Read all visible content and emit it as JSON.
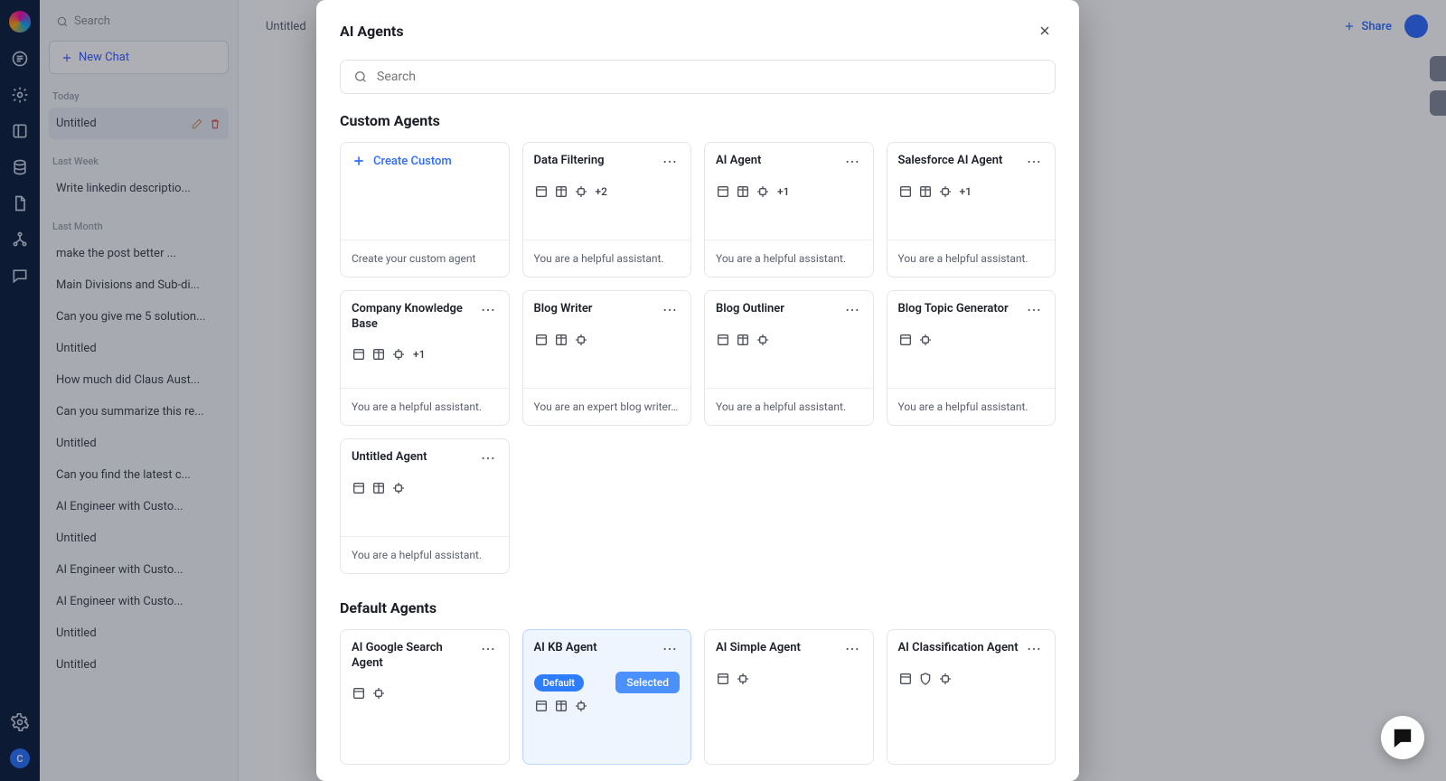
{
  "rail": {
    "icons": [
      "logo",
      "chat",
      "gear",
      "column",
      "database",
      "document",
      "tree",
      "bubble"
    ],
    "avatar_letter": "C"
  },
  "sidebar": {
    "search_placeholder": "Search",
    "new_chat_label": "New Chat",
    "today_label": "Today",
    "last_week_label": "Last Week",
    "last_month_label": "Last Month",
    "today_items": [
      "Untitled"
    ],
    "last_week_items": [
      "Write linkedin descriptio..."
    ],
    "last_month_items": [
      "make the post better ...",
      "Main Divisions and Sub-di...",
      "Can you give me 5 solution...",
      "Untitled",
      "How much did Claus Aust...",
      "Can you summarize this re...",
      "Untitled",
      "Can you find the latest c...",
      "AI Engineer with Custo...",
      "Untitled",
      "AI Engineer with Custo...",
      "AI Engineer with Custo...",
      "Untitled",
      "Untitled"
    ]
  },
  "topbar": {
    "untitled_label": "Untitled",
    "share_label": "Share"
  },
  "modal": {
    "title": "AI Agents",
    "search_placeholder": "Search",
    "custom_title": "Custom Agents",
    "default_title": "Default Agents",
    "create_label": "Create Custom",
    "create_desc": "Create your custom agent",
    "custom": [
      {
        "title": "Data Filtering",
        "desc": "You are a helpful assistant.",
        "plus": "+2",
        "icons": 3
      },
      {
        "title": "AI Agent",
        "desc": "You are a helpful assistant.",
        "plus": "+1",
        "icons": 3
      },
      {
        "title": "Salesforce AI Agent",
        "desc": "You are a helpful assistant.",
        "plus": "+1",
        "icons": 3
      },
      {
        "title": "Company Knowledge Base",
        "desc": "You are a helpful assistant.",
        "plus": "+1",
        "icons": 3
      },
      {
        "title": "Blog Writer",
        "desc": "You are an expert blog writer. Yo...",
        "plus": "",
        "icons": 3
      },
      {
        "title": "Blog Outliner",
        "desc": "You are a helpful assistant.",
        "plus": "",
        "icons": 3
      },
      {
        "title": "Blog Topic Generator",
        "desc": "You are a helpful assistant.",
        "plus": "",
        "icons": 2
      },
      {
        "title": "Untitled Agent",
        "desc": "You are a helpful assistant.",
        "plus": "",
        "icons": 3
      }
    ],
    "default": [
      {
        "title": "AI Google Search Agent",
        "icons": 2,
        "default": false,
        "selected": false
      },
      {
        "title": "AI KB Agent",
        "icons": 3,
        "default": true,
        "selected": true,
        "default_label": "Default",
        "selected_label": "Selected"
      },
      {
        "title": "AI Simple Agent",
        "icons": 2,
        "default": false,
        "selected": false
      },
      {
        "title": "AI Classification Agent",
        "icons": 3,
        "default": false,
        "selected": false
      }
    ]
  }
}
